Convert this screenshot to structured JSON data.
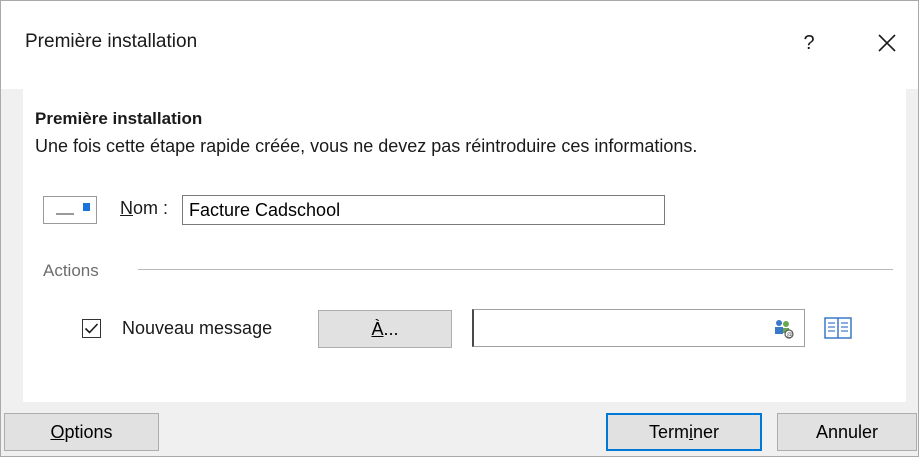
{
  "window": {
    "title": "Première installation"
  },
  "titlebar": {
    "help_label": "?",
    "close_icon": "close-icon"
  },
  "section": {
    "title": "Première installation",
    "description": "Une fois cette étape rapide créée, vous ne devez pas réintroduire ces informations."
  },
  "name_field": {
    "label_accel": "N",
    "label_rest": "om :",
    "value": "Facture Cadschool",
    "icon": "quick-step-icon"
  },
  "actions": {
    "label": "Actions",
    "new_message": {
      "checked": true,
      "label": "Nouveau message",
      "to_button_accel": "À",
      "to_button_rest": "...",
      "recipient_value": "",
      "check_names_icon": "check-names-icon",
      "address_book_icon": "address-book-icon"
    }
  },
  "footer": {
    "options_accel": "O",
    "options_rest": "ptions",
    "finish_pre": "Term",
    "finish_accel": "i",
    "finish_post": "ner",
    "cancel_label": "Annuler"
  },
  "colors": {
    "accent": "#0078d7",
    "icon_blue": "#1a73d9"
  }
}
